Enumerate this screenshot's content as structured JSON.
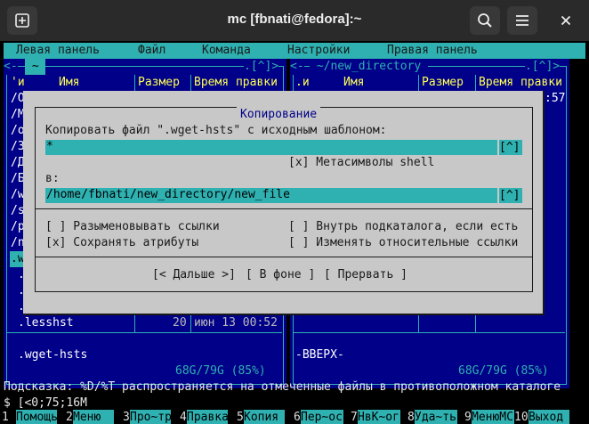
{
  "window": {
    "title": "mc [fbnati@fedora]:~"
  },
  "menubar": {
    "items": [
      "Левая панель",
      "Файл",
      "Команда",
      "Настройки",
      "Правая панель"
    ]
  },
  "left_panel": {
    "path": " ~ ",
    "corner": ".[^]>",
    "col_n": "'и",
    "col_name": "Имя",
    "col_size": "Размер",
    "col_time": "Время правки",
    "rows": [
      "/O",
      "/M",
      "/o",
      "/З",
      "/Д",
      "/Б",
      "/w",
      "/s",
      "/p",
      "/n"
    ],
    "selected_name": ".wget-hsts",
    "partial": [
      ".",
      ".",
      "."
    ],
    "bottom_name": ".lesshst",
    "bottom_size": "20",
    "bottom_time": "июн 13 00:52",
    "mini_status": ".wget-hsts",
    "free": "68G/79G (85%)"
  },
  "right_panel": {
    "path": " ~/new_directory ",
    "corner": ".[^]>",
    "col_n": ".и",
    "col_name": "Имя",
    "col_size": "Размер",
    "col_time": "Время правки",
    "time_fragment": ":57",
    "mini_status": "-ВВЕРХ-",
    "free": "68G/79G (85%)"
  },
  "dialog": {
    "title": "Копирование",
    "source_label": "Копировать файл \".wget-hsts\" с исходным шаблоном:",
    "source_value": "*",
    "hist_btn": "[^]",
    "shell_patterns": "[x] Метасимволы shell",
    "to_label": "в:",
    "to_value": "/home/fbnati/new_directory/new_file",
    "follow_links": "[ ] Разыменовывать ссылки",
    "into_subdir": "[ ] Внутрь подкаталога, если есть",
    "preserve_attrs": "[x] Сохранять атрибуты",
    "change_relative": "[ ] Изменять относительные ссылки",
    "btn_continue": "[< Дальше >]",
    "btn_background": "[ В фоне ]",
    "btn_abort": "[ Прервать ]"
  },
  "hint": "Подсказка: %D/%T распространяется на отмеченные файлы в противоположном каталоге",
  "prompt": "$ [<0;75;16M",
  "fkeys": [
    {
      "num": "1",
      "label": "Помощь"
    },
    {
      "num": "2",
      "label": "Меню"
    },
    {
      "num": "3",
      "label": "Про~тр"
    },
    {
      "num": "4",
      "label": "Правка"
    },
    {
      "num": "5",
      "label": "Копия"
    },
    {
      "num": "6",
      "label": "Пер~ос"
    },
    {
      "num": "7",
      "label": "НвК~ог"
    },
    {
      "num": "8",
      "label": "Уда~ть"
    },
    {
      "num": "9",
      "label": "МенюМС"
    },
    {
      "num": "10",
      "label": "Выход"
    }
  ],
  "colors": {
    "cyan": "#2fb1b1",
    "panel_bg": "#000088",
    "dialog_bg": "#c8c8c8",
    "titlebar": "#2a2a2a"
  },
  "icons": {
    "new_tab": "plus-in-square-icon",
    "search": "search-icon",
    "menu": "hamburger-icon",
    "close": "close-icon"
  }
}
